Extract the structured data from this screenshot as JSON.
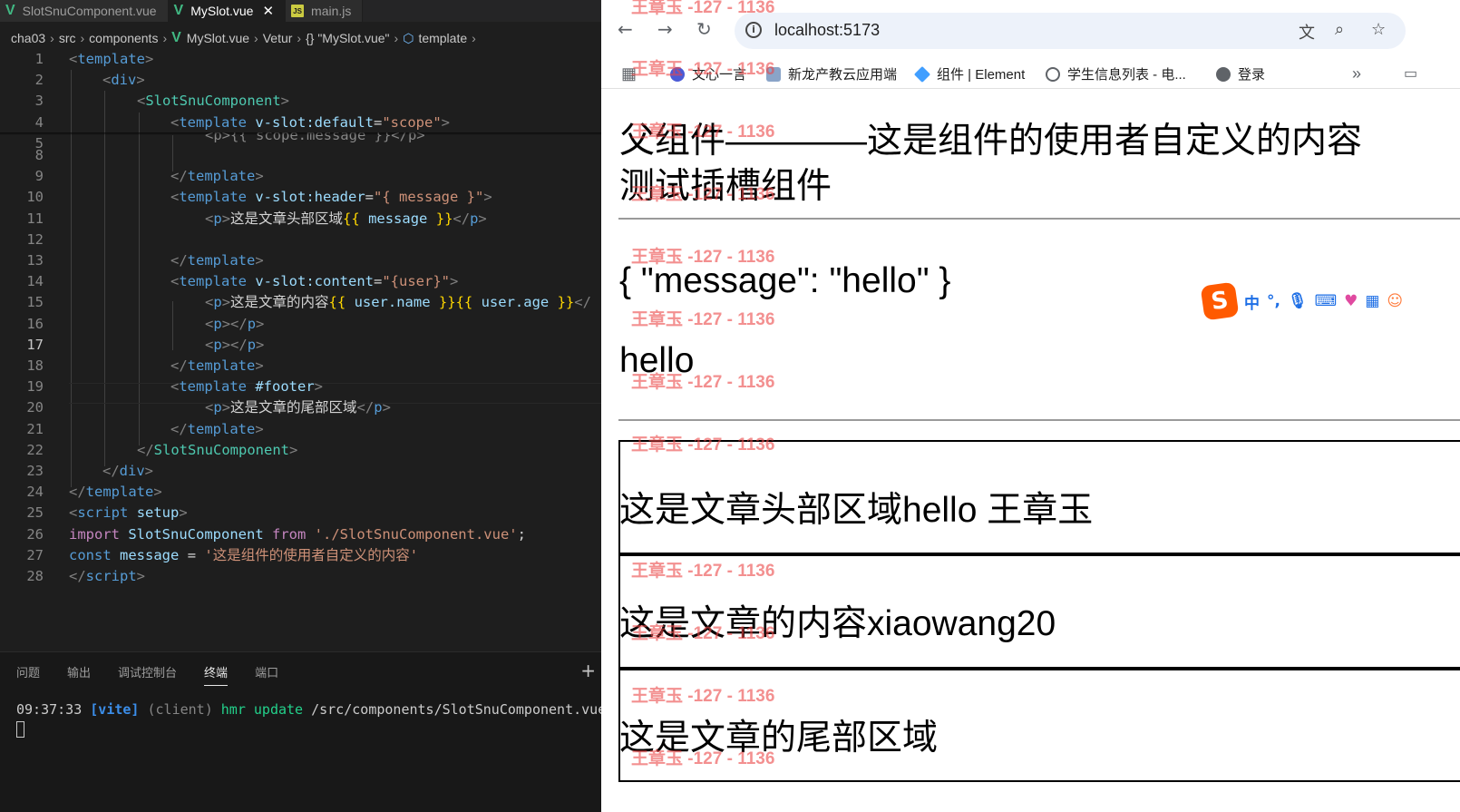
{
  "editor": {
    "tabs": [
      {
        "label": "SlotSnuComponent.vue",
        "icon": "vue-icon",
        "active": false
      },
      {
        "label": "MySlot.vue",
        "icon": "vue-icon",
        "active": true
      },
      {
        "label": "main.js",
        "icon": "js-icon",
        "active": false
      }
    ],
    "breadcrumb": [
      "cha03",
      "src",
      "components",
      "MySlot.vue",
      "Vetur",
      "{} \"MySlot.vue\"",
      "template"
    ],
    "current_line": 17,
    "line_numbers": [
      "1",
      "2",
      "3",
      "4",
      "5",
      "8",
      "9",
      "10",
      "11",
      "12",
      "13",
      "14",
      "15",
      "16",
      "17",
      "18",
      "19",
      "20",
      "21",
      "22",
      "23",
      "24",
      "25",
      "26",
      "27",
      "28"
    ],
    "scrolled_line_fragment": "<p>{{ scope.message }}</p>",
    "code": {
      "l1": "template",
      "l2": "div",
      "l3": "SlotSnuComponent",
      "l4_tag": "template",
      "l4_attr": "v-slot:default",
      "l4_val": "\"scope\"",
      "l7_tag": "template",
      "l8_tag": "template",
      "l8_attr": "v-slot:header",
      "l8_val": "\"{ message }\"",
      "l9_text": "这是文章头部区域",
      "l9_expr": "message",
      "l11_tag": "template",
      "l12_tag": "template",
      "l12_attr": "v-slot:content",
      "l12_val": "\"{user}\"",
      "l13_text": "这是文章的内容",
      "l13_expr1": "user.name",
      "l13_expr2": "user.age",
      "l16_tag": "template",
      "l17_tag": "template",
      "l17_attr": "#footer",
      "l18_text": "这是文章的尾部区域",
      "l19_tag": "template",
      "l20_tag": "SlotSnuComponent",
      "l21_tag": "div",
      "l22_tag": "template",
      "l23_tag": "script",
      "l23_attr": "setup",
      "l24_import": "import",
      "l24_name": "SlotSnuComponent",
      "l24_from": "from",
      "l24_path": "'./SlotSnuComponent.vue'",
      "l25_const": "const",
      "l25_name": "message",
      "l25_val": "'这是组件的使用者自定义的内容'",
      "l26_tag": "script"
    },
    "panel": {
      "tabs": [
        "问题",
        "输出",
        "调试控制台",
        "终端",
        "端口"
      ],
      "active_tab": "终端",
      "terminal": {
        "time": "09:37:33",
        "tag": "[vite]",
        "client": "(client)",
        "action": "hmr update",
        "path": "/src/components/SlotSnuComponent.vue"
      }
    }
  },
  "browser": {
    "url": "localhost:5173",
    "bookmarks": [
      "文心一言",
      "新龙产教云应用端",
      "组件 | Element",
      "学生信息列表 - 电...",
      "登录"
    ],
    "page": {
      "heading_line1": "父组件————这是组件的使用者自定义的内容",
      "heading_line2": "测试插槽组件",
      "json_text": "{ \"message\": \"hello\" }",
      "hello_text": "hello",
      "header_box": "这是文章头部区域hello 王章玉",
      "content_box": "这是文章的内容xiaowang20",
      "footer_box": "这是文章的尾部区域"
    },
    "watermark": "王章玉 -127 - 1136",
    "ime": {
      "logo": "S",
      "lang": "中"
    }
  },
  "colors": {
    "editor_bg": "#1e1e1e",
    "tag": "#569cd6",
    "attr": "#9cdcfe",
    "string": "#ce9178",
    "vue_green": "#41b883",
    "watermark": "#eb4646"
  }
}
